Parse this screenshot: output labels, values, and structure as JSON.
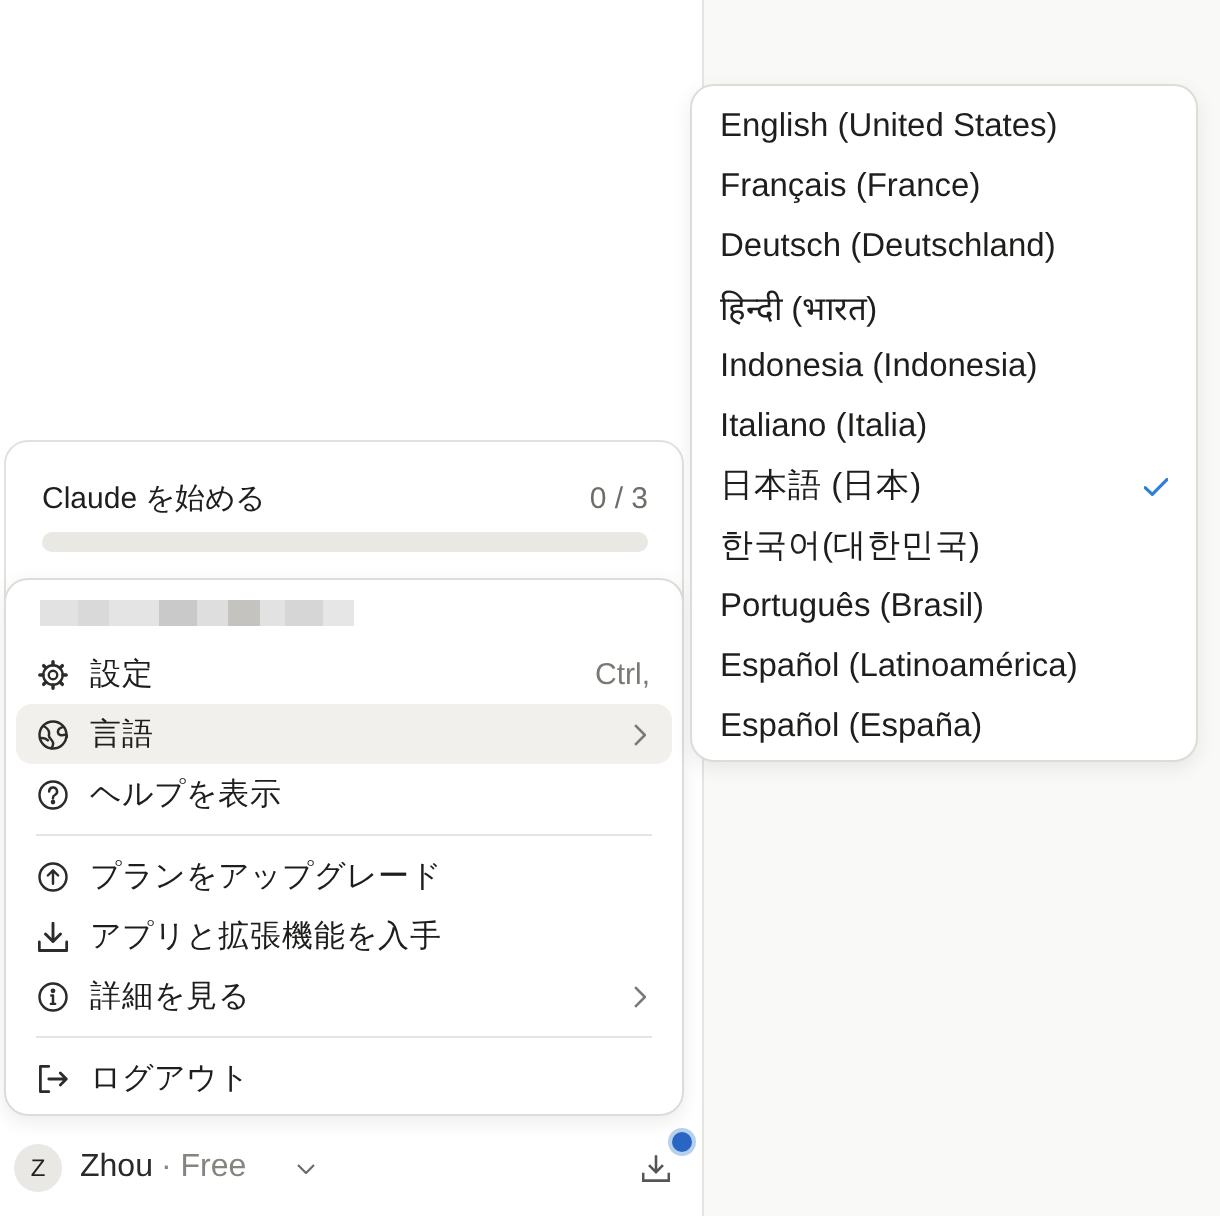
{
  "onboarding": {
    "title": "Claude を始める",
    "progress": "0 / 3",
    "level": 0
  },
  "account_menu": {
    "items": [
      {
        "kind": "item",
        "label": "設定",
        "shortcut": "Ctrl,",
        "submenu": false,
        "selected": false
      },
      {
        "kind": "item",
        "label": "言語",
        "submenu": true,
        "selected": true
      },
      {
        "kind": "item",
        "label": "ヘルプを表示",
        "submenu": false,
        "selected": false
      },
      {
        "kind": "divider"
      },
      {
        "kind": "item",
        "label": "プランをアップグレード",
        "submenu": false,
        "selected": false
      },
      {
        "kind": "item",
        "label": "アプリと拡張機能を入手",
        "submenu": false,
        "selected": false
      },
      {
        "kind": "item",
        "label": "詳細を見る",
        "submenu": true,
        "selected": false
      },
      {
        "kind": "divider"
      },
      {
        "kind": "item",
        "label": "ログアウト",
        "submenu": false,
        "selected": false
      }
    ]
  },
  "language_menu": {
    "items": [
      {
        "label": "English (United States)",
        "selected": false
      },
      {
        "label": "Français (France)",
        "selected": false
      },
      {
        "label": "Deutsch (Deutschland)",
        "selected": false
      },
      {
        "label": "हिन्दी (भारत)",
        "selected": false
      },
      {
        "label": "Indonesia (Indonesia)",
        "selected": false
      },
      {
        "label": "Italiano (Italia)",
        "selected": false
      },
      {
        "label": "日本語 (日本)",
        "selected": true
      },
      {
        "label": "한국어(대한민국)",
        "selected": false
      },
      {
        "label": "Português (Brasil)",
        "selected": false
      },
      {
        "label": "Español (Latinoamérica)",
        "selected": false
      },
      {
        "label": "Español (España)",
        "selected": false
      }
    ]
  },
  "user_bar": {
    "initial": "Z",
    "name": "Zhou",
    "plan": "· Free",
    "download_badge": true
  }
}
